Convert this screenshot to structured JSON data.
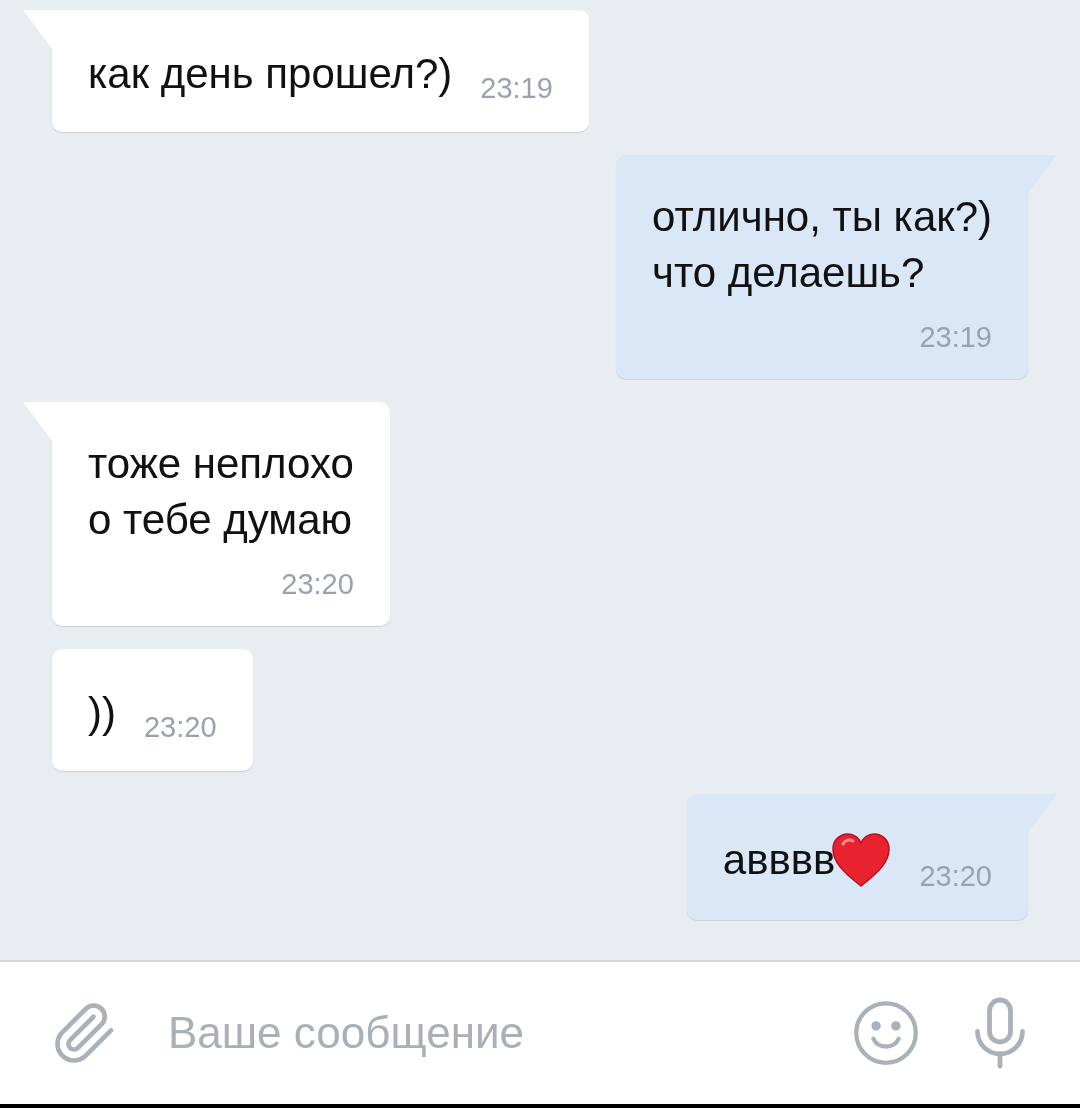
{
  "messages": [
    {
      "kind": "incoming",
      "tail": true,
      "lines": [
        "как день прошел?)"
      ],
      "time": "23:19"
    },
    {
      "kind": "outgoing",
      "tail": true,
      "lines": [
        "отлично, ты как?)",
        "что делаешь?"
      ],
      "time": "23:19"
    },
    {
      "kind": "incoming",
      "tail": true,
      "lines": [
        "тоже неплохо",
        "о тебе думаю"
      ],
      "time": "23:20"
    },
    {
      "kind": "incoming",
      "tail": false,
      "lines": [
        "))"
      ],
      "time": "23:20"
    },
    {
      "kind": "outgoing",
      "tail": true,
      "lines": [
        "авввв"
      ],
      "heart_emoji": true,
      "time": "23:20"
    }
  ],
  "composer": {
    "placeholder": "Ваше сообщение"
  }
}
